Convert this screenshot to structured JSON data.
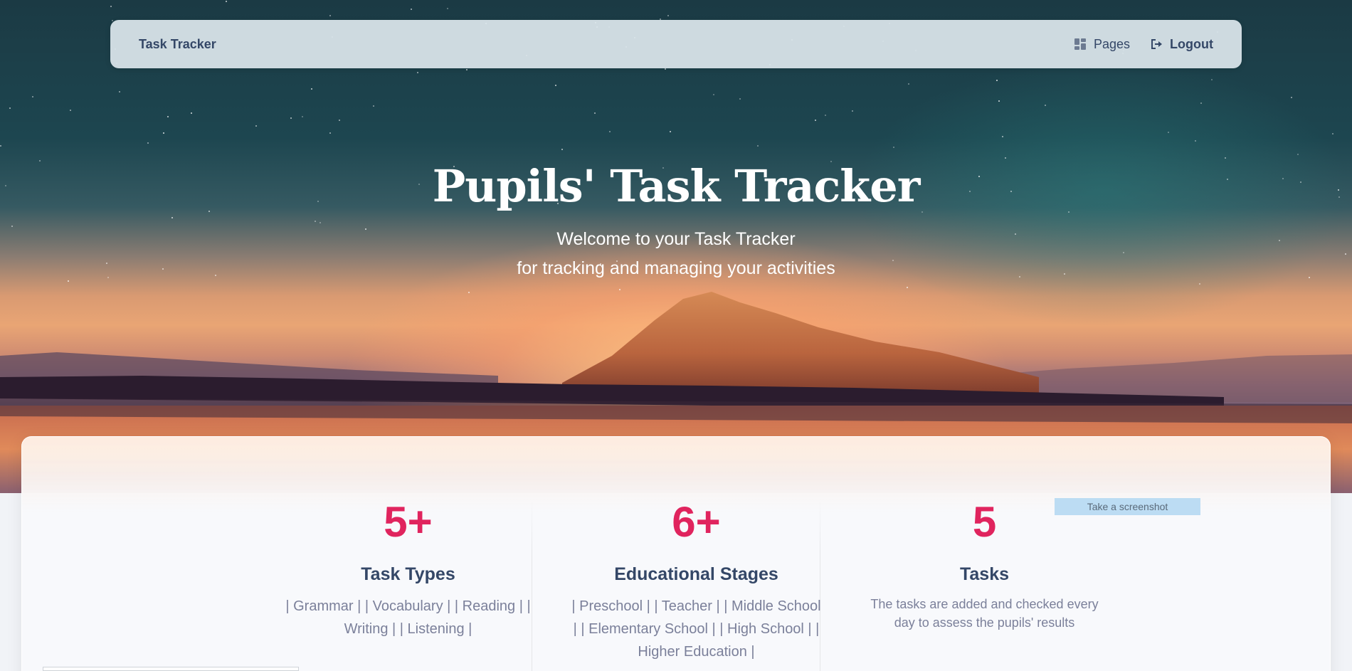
{
  "navbar": {
    "brand": "Task Tracker",
    "links": [
      {
        "label": "Pages",
        "icon": "dashboard-icon"
      },
      {
        "label": "Logout",
        "icon": "logout-icon"
      }
    ]
  },
  "hero": {
    "title": "Pupils' Task Tracker",
    "subtitle_line1": "Welcome to your Task Tracker",
    "subtitle_line2": "for tracking and managing your activities"
  },
  "stats": [
    {
      "number": "5+",
      "label": "Task Types",
      "description": "| Grammar | | Vocabulary | | Reading | | Writing | | Listening |"
    },
    {
      "number": "6+",
      "label": "Educational Stages",
      "description": "| Preschool | | Teacher | | Middle School | | Elementary School | | High School | | Higher Education |"
    },
    {
      "number": "5",
      "label": "Tasks",
      "description": "The tasks are added and checked every day to assess the pupils' results"
    }
  ],
  "screenshot_button": "Take a screenshot",
  "colors": {
    "accent": "#e0245e",
    "heading": "#344767",
    "muted": "#7b809a"
  }
}
